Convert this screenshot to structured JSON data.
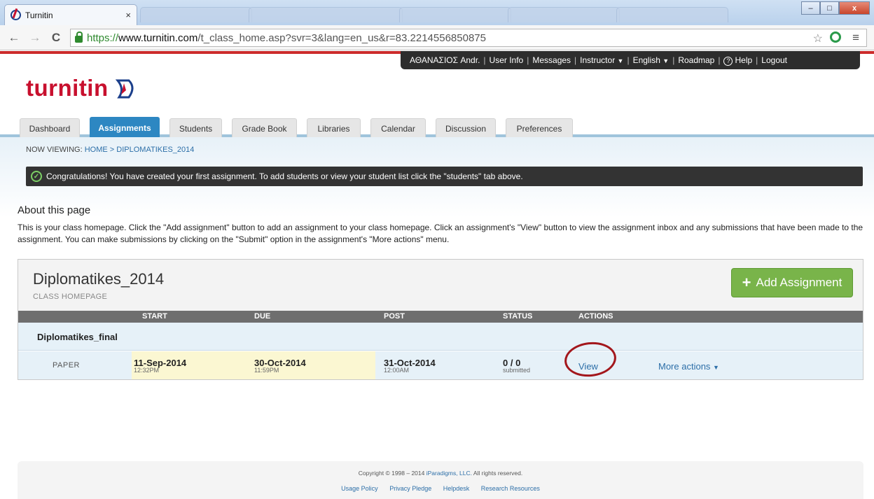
{
  "browser": {
    "tab_title": "Turnitin",
    "tab_close": "×",
    "url_scheme": "https://",
    "url_host": "www.turnitin.com",
    "url_path": "/t_class_home.asp?svr=3&lang=en_us&r=83.2214556850875",
    "back_icon": "←",
    "forward_icon": "→",
    "reload_icon": "C",
    "star_icon": "☆",
    "menu_icon": "≡",
    "win_min": "–",
    "win_max": "□",
    "win_close": "x"
  },
  "userbar": {
    "user": "ΑΘΑΝΑΣΙΟΣ Andr.",
    "user_info": "User Info",
    "messages": "Messages",
    "role": "Instructor",
    "language": "English",
    "roadmap": "Roadmap",
    "help": "Help",
    "help_icon": "?",
    "logout": "Logout",
    "caret": "▼",
    "sep": "|"
  },
  "logo": {
    "text": "turnitin"
  },
  "nav_tabs": [
    "Dashboard",
    "Assignments",
    "Students",
    "Grade Book",
    "Libraries",
    "Calendar",
    "Discussion",
    "Preferences"
  ],
  "breadcrumb": {
    "prefix": "NOW VIEWING:",
    "home": "HOME",
    "sep": ">",
    "current": "DIPLOMATIKES_2014"
  },
  "banner": {
    "check": "✓",
    "text": "Congratulations! You have created your first assignment. To add students or view your student list click the \"students\" tab above."
  },
  "about": {
    "heading": "About this page",
    "text": "This is your class homepage. Click the \"Add assignment\" button to add an assignment to your class homepage. Click an assignment's \"View\" button to view the assignment inbox and any submissions that have been made to the assignment. You can make submissions by clicking on the \"Submit\" option in the assignment's \"More actions\" menu."
  },
  "class": {
    "title": "Diplomatikes_2014",
    "subtitle": "CLASS HOMEPAGE",
    "add_button": "Add Assignment",
    "add_icon": "+"
  },
  "columns": [
    "START",
    "DUE",
    "POST",
    "STATUS",
    "ACTIONS"
  ],
  "assignment": {
    "name": "Diplomatikes_final",
    "type": "PAPER",
    "start_date": "11-Sep-2014",
    "start_time": "12:32PM",
    "due_date": "30-Oct-2014",
    "due_time": "11:59PM",
    "post_date": "31-Oct-2014",
    "post_time": "12:00AM",
    "status": "0 / 0",
    "status_sub": "submitted",
    "view": "View",
    "more_actions": "More actions",
    "more_caret": "▼"
  },
  "colors": {
    "brand_red": "#c8102e",
    "active_tab": "#2d87c2",
    "add_green": "#79b44a",
    "annotation_circle": "#a3171c"
  },
  "footer": {
    "copyright_prefix": "Copyright © 1998 – 2014",
    "company": "iParadigms, LLC.",
    "copyright_suffix": "All rights reserved.",
    "links": [
      "Usage Policy",
      "Privacy Pledge",
      "Helpdesk",
      "Research Resources"
    ]
  }
}
